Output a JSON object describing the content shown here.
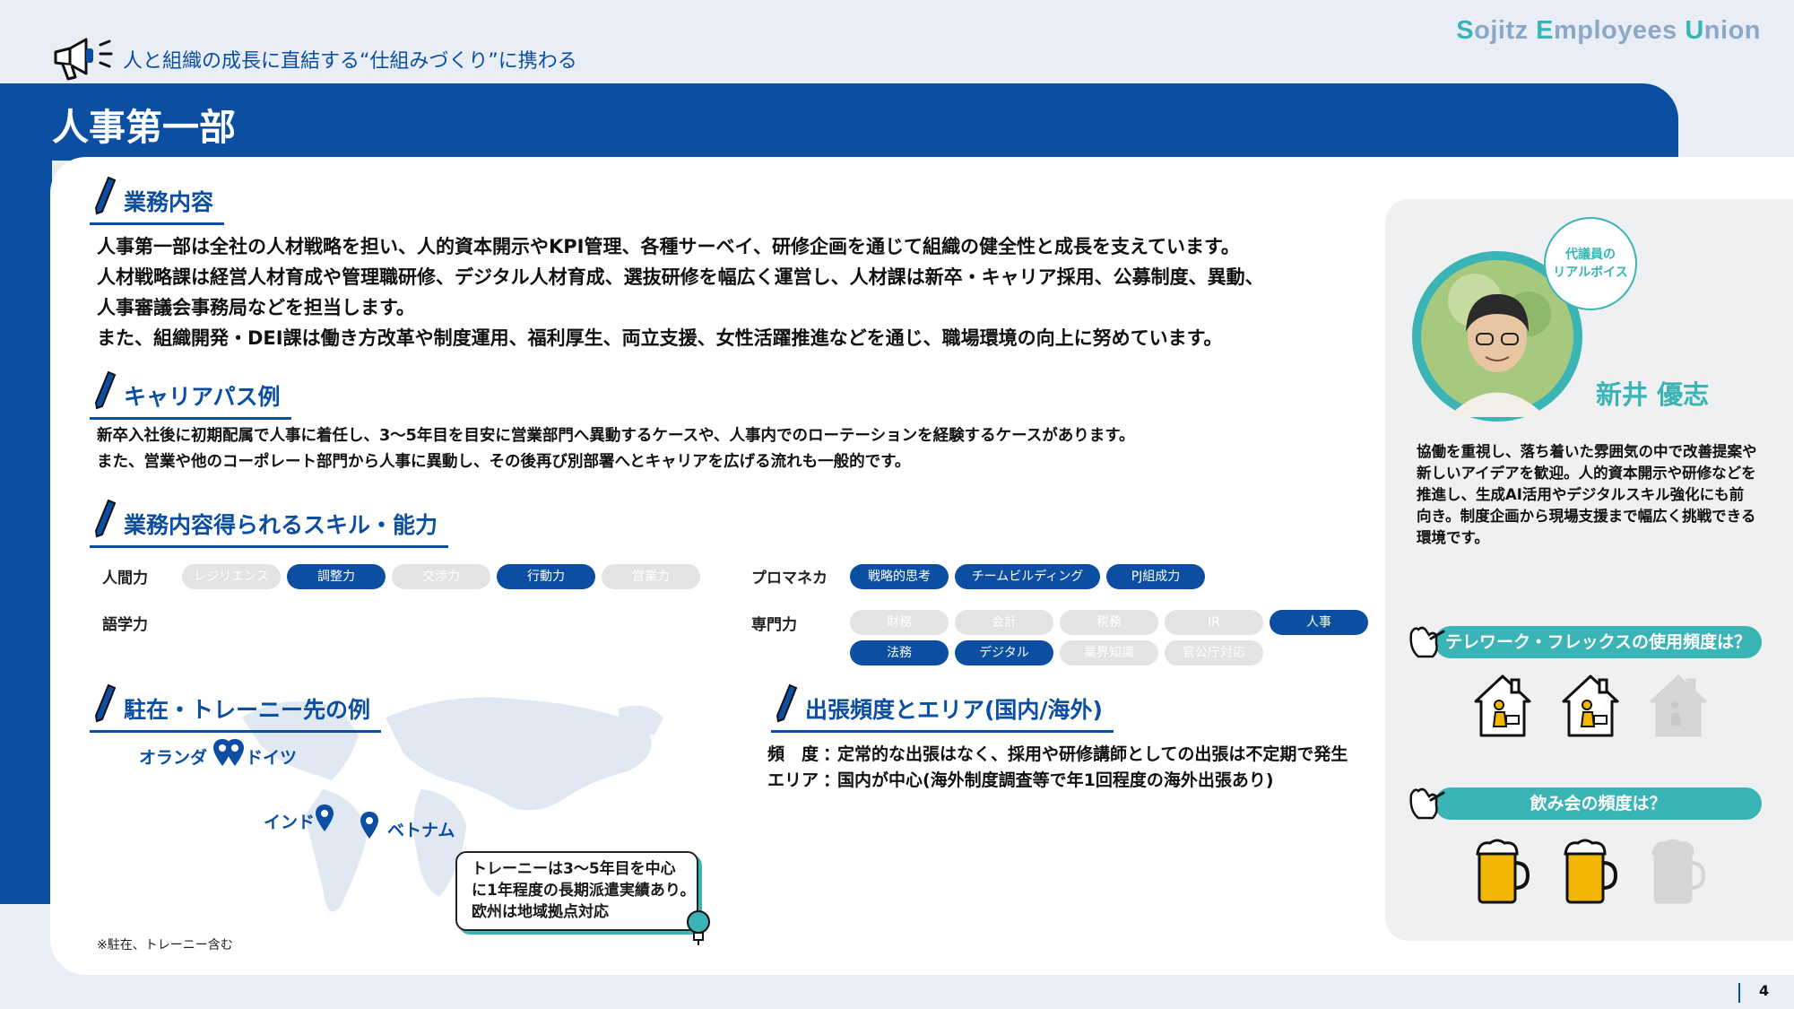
{
  "header": {
    "brand": {
      "s": "S",
      "ojitz": "ojitz ",
      "e": "E",
      "mployees": "mployees ",
      "u": "U",
      "nion": "nion"
    },
    "tagline": "人と組織の成長に直結する“仕組みづくり”に携わる",
    "title": "人事第一部"
  },
  "sections": {
    "work": {
      "heading": "業務内容",
      "lines": [
        "人事第一部は全社の人材戦略を担い、人的資本開示やKPI管理、各種サーベイ、研修企画を通じて組織の健全性と成長を支えています。",
        "人材戦略課は経営人材育成や管理職研修、デジタル人材育成、選抜研修を幅広く運営し、人材課は新卒・キャリア採用、公募制度、異動、",
        "人事審議会事務局などを担当します。",
        "また、組織開発・DEI課は働き方改革や制度運用、福利厚生、両立支援、女性活躍推進などを通じ、職場環境の向上に努めています。"
      ]
    },
    "career": {
      "heading": "キャリアパス例",
      "lines": [
        "新卒入社後に初期配属で人事に着任し、3～5年目を目安に営業部門へ異動するケースや、人事内でのローテーションを経験するケースがあります。",
        "また、営業や他のコーポレート部門から人事に異動し、その後再び別部署へとキャリアを広げる流れも一般的です。"
      ]
    },
    "skills": {
      "heading": "業務内容得られるスキル・能力",
      "groups": [
        {
          "label": "人間力",
          "items": [
            {
              "text": "レジリエンス",
              "on": false
            },
            {
              "text": "調整力",
              "on": true
            },
            {
              "text": "交渉力",
              "on": false
            },
            {
              "text": "行動力",
              "on": true
            },
            {
              "text": "営業力",
              "on": false
            }
          ]
        },
        {
          "label": "プロマネカ",
          "items": [
            {
              "text": "戦略的思考",
              "on": true
            },
            {
              "text": "チームビルディング",
              "on": true
            },
            {
              "text": "PJ組成力",
              "on": true
            }
          ]
        },
        {
          "label": "語学力",
          "items": []
        },
        {
          "label": "専門力",
          "items": [
            {
              "text": "財務",
              "on": false
            },
            {
              "text": "会計",
              "on": false
            },
            {
              "text": "税務",
              "on": false
            },
            {
              "text": "IR",
              "on": false
            },
            {
              "text": "人事",
              "on": true
            },
            {
              "text": "法務",
              "on": true
            },
            {
              "text": "デジタル",
              "on": true
            },
            {
              "text": "業界知識",
              "on": false
            },
            {
              "text": "官公庁対応",
              "on": false
            }
          ]
        }
      ]
    },
    "overseas": {
      "heading": "駐在・トレーニー先の例",
      "cities": [
        "オランダ",
        "ドイツ",
        "インド",
        "ベトナム"
      ],
      "note": [
        "トレーニーは3～5年目を中心",
        "に1年程度の長期派遣実績あり。",
        "欧州は地域拠点対応"
      ],
      "footnote": "※駐在、トレーニー含む"
    },
    "travel": {
      "heading": "出張頻度とエリア(国内/海外)",
      "freq_label": "頻　度",
      "freq_value": "定常的な出張はなく、採用や研修講師としての出張は不定期で発生",
      "area_label": "エリア",
      "area_value": "国内が中心(海外制度調査等で年1回程度の海外出張あり)",
      "sep": "："
    }
  },
  "profile": {
    "bubble": [
      "代議員の",
      "リアルボイス"
    ],
    "name": "新井 優志",
    "desc": "協働を重視し、落ち着いた雰囲気の中で改善提案や新しいアイデアを歓迎。人的資本開示や研修などを推進し、生成AI活用やデジタルスキル強化にも前向き。制度企画から現場支援まで幅広く挑戦できる環境です。",
    "q1": "テレワーク・フレックスの使用頻度は？",
    "q1_level": 2,
    "q1_max": 3,
    "q2": "飲み会の頻度は？",
    "q2_level": 2,
    "q2_max": 3
  },
  "colors": {
    "primary": "#0b4ea2",
    "accent": "#3ab4b4",
    "inactive": "#e3e3e3"
  },
  "page_number": "4"
}
